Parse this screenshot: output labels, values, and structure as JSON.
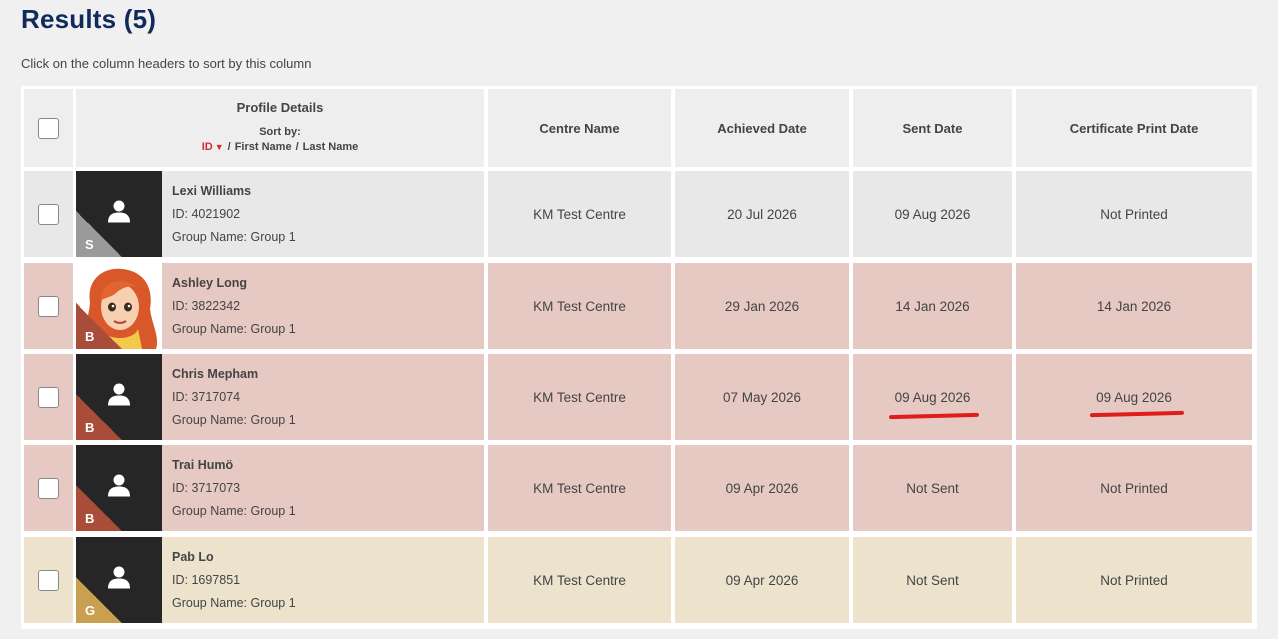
{
  "page": {
    "title": "Results (5)",
    "hint": "Click on the column headers to sort by this column"
  },
  "columns": {
    "profile_details": "Profile Details",
    "sort_by": "Sort by:",
    "sort_id": "ID",
    "sort_first": "First Name",
    "sort_last": "Last Name",
    "centre": "Centre Name",
    "achieved": "Achieved Date",
    "sent": "Sent Date",
    "print": "Certificate Print Date"
  },
  "colors": {
    "title": "#0f2a5c",
    "silver_row": "#e8e8e8",
    "bronze_row": "#e6c9c3",
    "gold_row": "#ede3cd",
    "silver_badge": "#9a9a9a",
    "bronze_badge": "#a94d3a",
    "gold_badge": "#c8a050",
    "annotation": "#e01c1c"
  },
  "rows": [
    {
      "name": "Lexi Williams",
      "id": "ID: 4021902",
      "group": "Group Name: Group 1",
      "badge": "S",
      "tier": "silver",
      "avatar": "person-icon",
      "centre": "KM Test Centre",
      "achieved": "20 Jul 2026",
      "sent": "09 Aug 2026",
      "print": "Not Printed"
    },
    {
      "name": "Ashley Long",
      "id": "ID: 3822342",
      "group": "Group Name: Group 1",
      "badge": "B",
      "tier": "bronze",
      "avatar": "cartoon-portrait",
      "centre": "KM Test Centre",
      "achieved": "29 Jan 2026",
      "sent": "14 Jan 2026",
      "print": "14 Jan 2026"
    },
    {
      "name": "Chris Mepham",
      "id": "ID: 3717074",
      "group": "Group Name: Group 1",
      "badge": "B",
      "tier": "bronze",
      "avatar": "person-icon",
      "centre": "KM Test Centre",
      "achieved": "07 May 2026",
      "sent": "09 Aug 2026",
      "print": "09 Aug 2026"
    },
    {
      "name": "Trai Humö",
      "id": "ID: 3717073",
      "group": "Group Name: Group 1",
      "badge": "B",
      "tier": "bronze",
      "avatar": "person-icon",
      "centre": "KM Test Centre",
      "achieved": "09 Apr 2026",
      "sent": "Not Sent",
      "print": "Not Printed"
    },
    {
      "name": "Pab Lo",
      "id": "ID: 1697851",
      "group": "Group Name: Group 1",
      "badge": "G",
      "tier": "gold",
      "avatar": "person-icon",
      "centre": "KM Test Centre",
      "achieved": "09 Apr 2026",
      "sent": "Not Sent",
      "print": "Not Printed"
    }
  ]
}
